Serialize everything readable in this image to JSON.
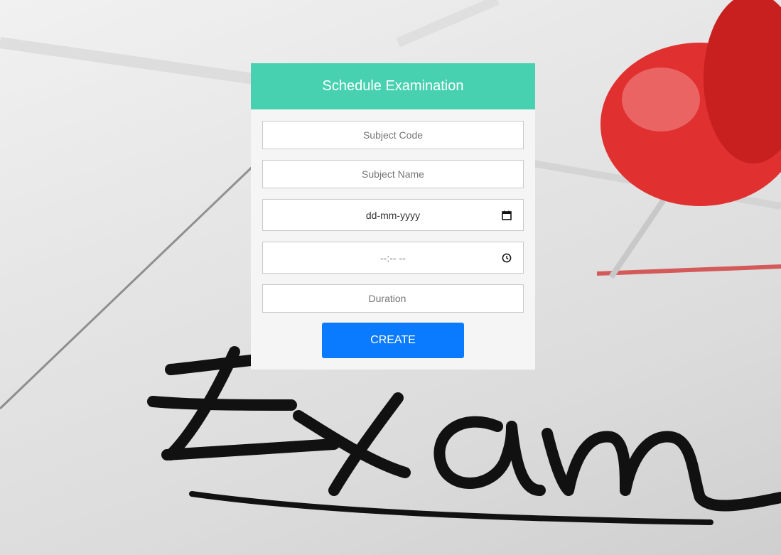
{
  "form": {
    "title": "Schedule Examination",
    "subject_code_placeholder": "Subject Code",
    "subject_name_placeholder": "Subject Name",
    "date_placeholder": "dd-mm-yyyy",
    "time_placeholder": "--:-- --",
    "duration_placeholder": "Duration",
    "create_label": "CREATE"
  },
  "icons": {
    "date": "calendar-icon",
    "time": "clock-icon"
  },
  "colors": {
    "header": "#47d1b0",
    "button": "#0a7bff",
    "card": "#f5f5f5"
  }
}
